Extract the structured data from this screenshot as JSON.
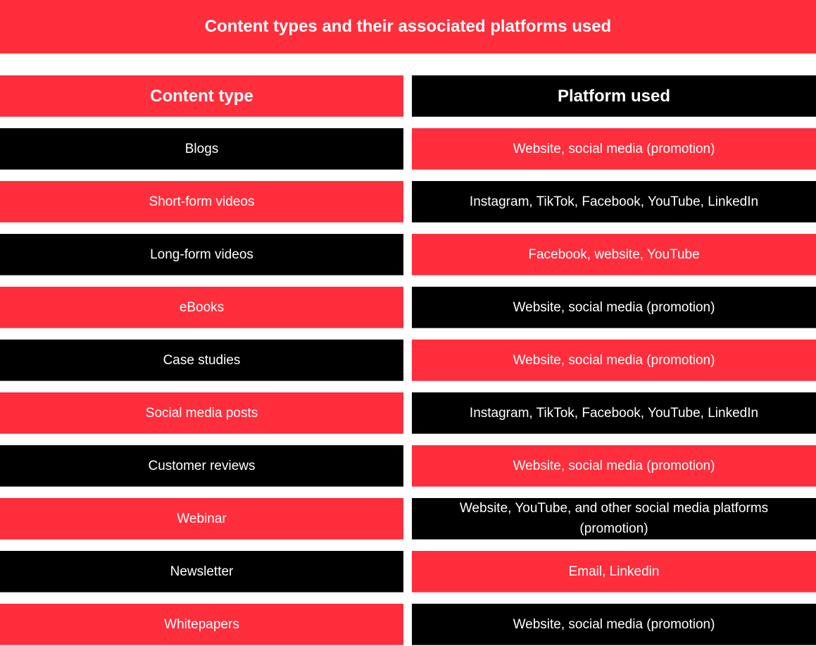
{
  "title": "Content types and their associated platforms used",
  "colors": {
    "red": "#FF2E3C",
    "black": "#000000",
    "text": "#FFFFFF"
  },
  "table": {
    "headers": {
      "content_type": "Content type",
      "platform": "Platform used"
    },
    "rows": [
      {
        "content_type": "Blogs",
        "platform": "Website, social media (promotion)"
      },
      {
        "content_type": "Short-form videos",
        "platform": "Instagram, TikTok, Facebook, YouTube, LinkedIn"
      },
      {
        "content_type": "Long-form videos",
        "platform": "Facebook, website, YouTube"
      },
      {
        "content_type": "eBooks",
        "platform": "Website, social media (promotion)"
      },
      {
        "content_type": "Case studies",
        "platform": "Website, social media (promotion)"
      },
      {
        "content_type": "Social media posts",
        "platform": "Instagram, TikTok, Facebook, YouTube, LinkedIn"
      },
      {
        "content_type": "Customer reviews",
        "platform": "Website, social media (promotion)"
      },
      {
        "content_type": "Webinar",
        "platform": "Website, YouTube, and other social media platforms (promotion)"
      },
      {
        "content_type": "Newsletter",
        "platform": "Email, Linkedin"
      },
      {
        "content_type": "Whitepapers",
        "platform": "Website, social media (promotion)"
      }
    ]
  }
}
